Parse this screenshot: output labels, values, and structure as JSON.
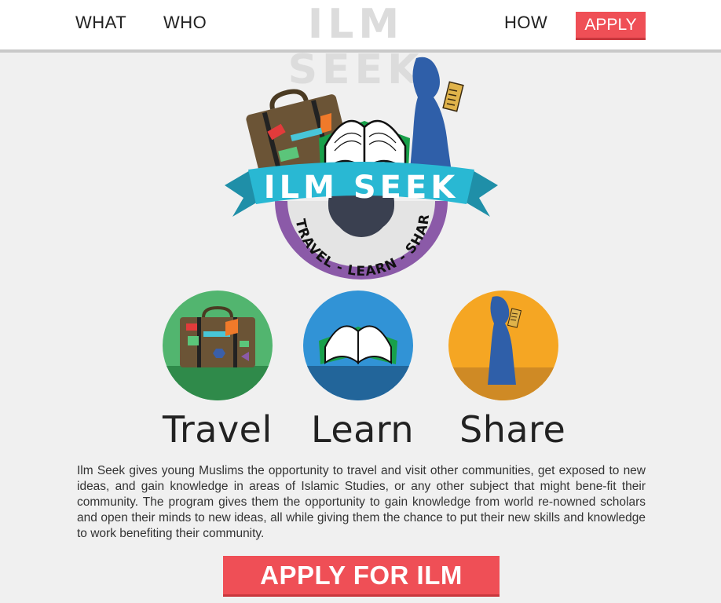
{
  "nav": {
    "what": "WHAT",
    "who": "WHO",
    "logo": "ILM SEEK",
    "how": "HOW",
    "apply": "APPLY"
  },
  "hero": {
    "banner_text": "ILM SEEK",
    "tagline": "TRAVEL - LEARN - SHARE",
    "colors": {
      "banner": "#29b8d3",
      "ring": "#8b5aa8",
      "dome": "#3a4050",
      "figure": "#2f5fa9"
    }
  },
  "features": [
    {
      "label": "Travel",
      "icon": "suitcase-icon",
      "color": "#52b56f",
      "ground": "#2f8a4a"
    },
    {
      "label": "Learn",
      "icon": "open-book-icon",
      "color": "#3193d6",
      "ground": "#22659a"
    },
    {
      "label": "Share",
      "icon": "reading-figure-icon",
      "color": "#f5a623",
      "ground": "#cf8a25"
    }
  ],
  "description": "Ilm Seek gives young Muslims the opportunity to travel and visit other communities, get exposed to new ideas, and gain knowledge in areas of Islamic Studies, or any other subject that might bene-fit their community. The program gives them the opportunity to gain knowledge from world re-nowned scholars and open their minds to new ideas, all while giving them the chance to put their new skills and knowledge to work benefiting their community.",
  "cta": "APPLY FOR ILM SEEK",
  "colors": {
    "accent": "#ef4f56",
    "background": "#f0f0f0"
  }
}
